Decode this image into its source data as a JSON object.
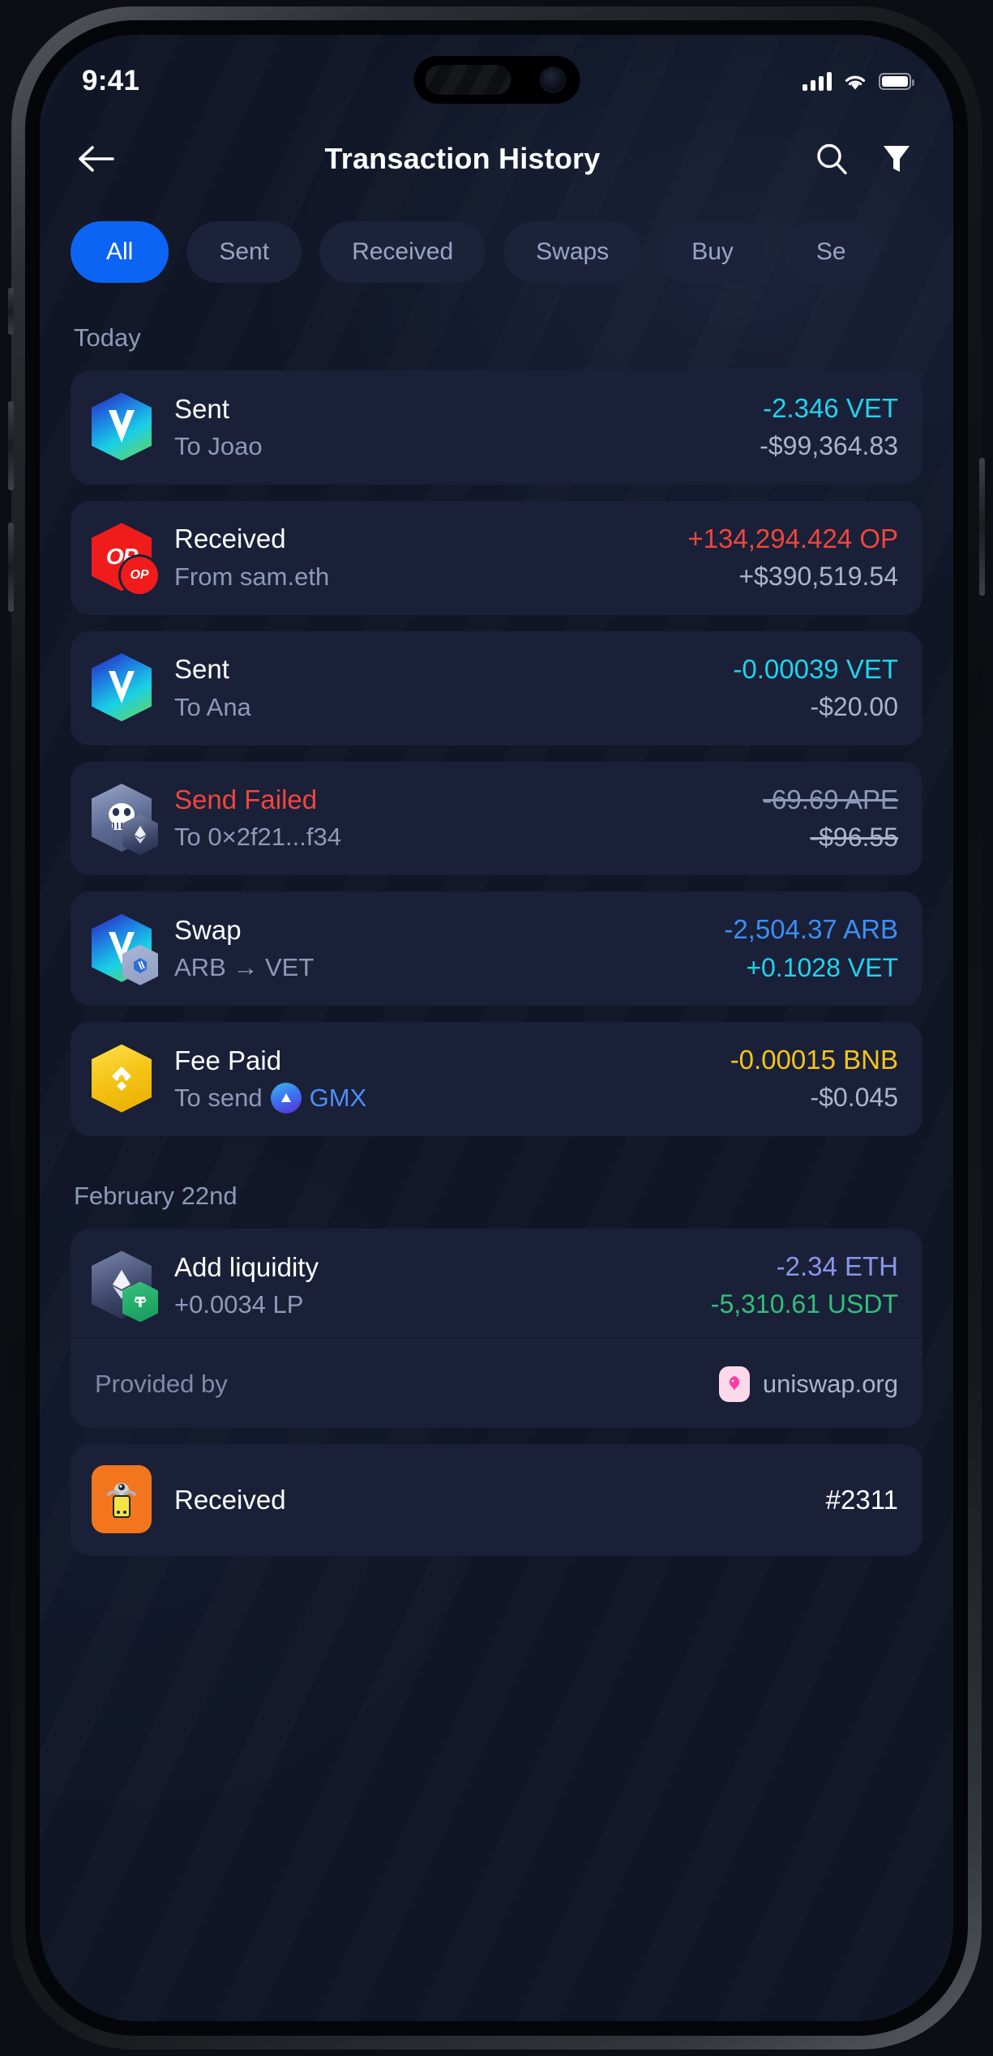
{
  "status_bar": {
    "time": "9:41",
    "signal_icon": "cellular-signal-icon",
    "wifi_icon": "wifi-icon",
    "battery_icon": "battery-icon"
  },
  "header": {
    "back_icon": "back-arrow-icon",
    "title": "Transaction History",
    "search_icon": "search-icon",
    "filter_icon": "filter-icon"
  },
  "filters": {
    "chips": [
      {
        "label": "All",
        "active": true
      },
      {
        "label": "Sent",
        "active": false
      },
      {
        "label": "Received",
        "active": false
      },
      {
        "label": "Swaps",
        "active": false
      },
      {
        "label": "Buy",
        "active": false
      },
      {
        "label": "Se",
        "active": false
      }
    ]
  },
  "colors": {
    "accent_blue": "#0b64f4",
    "page_bg": "#101626",
    "card_bg": "#1a2038",
    "cyan": "#1fd4ee",
    "red": "#f1453d",
    "blue": "#3d8ef5",
    "yellow": "#f5c518",
    "green": "#2fc07a",
    "periwinkle": "#8a96e8",
    "muted": "#8e99b8"
  },
  "sections": [
    {
      "day_label": "Today",
      "transactions": [
        {
          "icon": "vechain-token-icon",
          "badge": null,
          "title": "Sent",
          "title_state": "normal",
          "subtitle": "To Joao",
          "amount": "-2.346 VET",
          "amount_color": "#1fd4ee",
          "amount_strike": false,
          "fiat": "-$99,364.83",
          "fiat_color": "#aab3cd",
          "fiat_strike": false
        },
        {
          "icon": "optimism-token-icon",
          "badge": "optimism-badge-icon",
          "title": "Received",
          "title_state": "normal",
          "subtitle": "From sam.eth",
          "amount": "+134,294.424 OP",
          "amount_color": "#f1453d",
          "amount_strike": false,
          "fiat": "+$390,519.54",
          "fiat_color": "#aab3cd",
          "fiat_strike": false
        },
        {
          "icon": "vechain-token-icon",
          "badge": null,
          "title": "Sent",
          "title_state": "normal",
          "subtitle": "To Ana",
          "amount": "-0.00039 VET",
          "amount_color": "#1fd4ee",
          "amount_strike": false,
          "fiat": "-$20.00",
          "fiat_color": "#aab3cd",
          "fiat_strike": false
        },
        {
          "icon": "apecoin-token-icon",
          "badge": "ethereum-badge-icon",
          "title": "Send Failed",
          "title_state": "failed",
          "subtitle": "To 0×2f21...f34",
          "amount": "-69.69 APE",
          "amount_color": "#8e99b8",
          "amount_strike": true,
          "fiat": "-$96.55",
          "fiat_color": "#aab3cd",
          "fiat_strike": true
        },
        {
          "icon": "vechain-token-icon",
          "badge": "arbitrum-badge-icon",
          "title": "Swap",
          "title_state": "normal",
          "subtitle": "ARB → VET",
          "amount": "-2,504.37 ARB",
          "amount_color": "#3d8ef5",
          "amount_strike": false,
          "fiat": "+0.1028 VET",
          "fiat_color": "#1fd4ee",
          "fiat_strike": false
        },
        {
          "icon": "bnb-token-icon",
          "badge": null,
          "title": "Fee Paid",
          "title_state": "normal",
          "subtitle": "To send",
          "subtitle_chip_icon": "gmx-token-icon",
          "subtitle_chip_label": "GMX",
          "amount": "-0.00015 BNB",
          "amount_color": "#f5c518",
          "amount_strike": false,
          "fiat": "-$0.045",
          "fiat_color": "#aab3cd",
          "fiat_strike": false
        }
      ]
    },
    {
      "day_label": "February 22nd",
      "transactions": [
        {
          "icon": "ethereum-token-icon",
          "badge": "usdt-badge-icon",
          "title": "Add liquidity",
          "title_state": "normal",
          "subtitle": "+0.0034 LP",
          "amount": "-2.34 ETH",
          "amount_color": "#8a96e8",
          "amount_strike": false,
          "fiat": "-5,310.61 USDT",
          "fiat_color": "#2fc07a",
          "fiat_strike": false,
          "provided_by_label": "Provided by",
          "provided_by_icon": "uniswap-icon",
          "provided_by_name": "uniswap.org"
        },
        {
          "icon": "nft-collection-icon",
          "badge": null,
          "title": "Received",
          "title_state": "normal",
          "subtitle": "",
          "amount": "#2311",
          "amount_color": "#ffffff",
          "amount_strike": false,
          "fiat": "",
          "fiat_color": "#aab3cd",
          "fiat_strike": false
        }
      ]
    }
  ]
}
